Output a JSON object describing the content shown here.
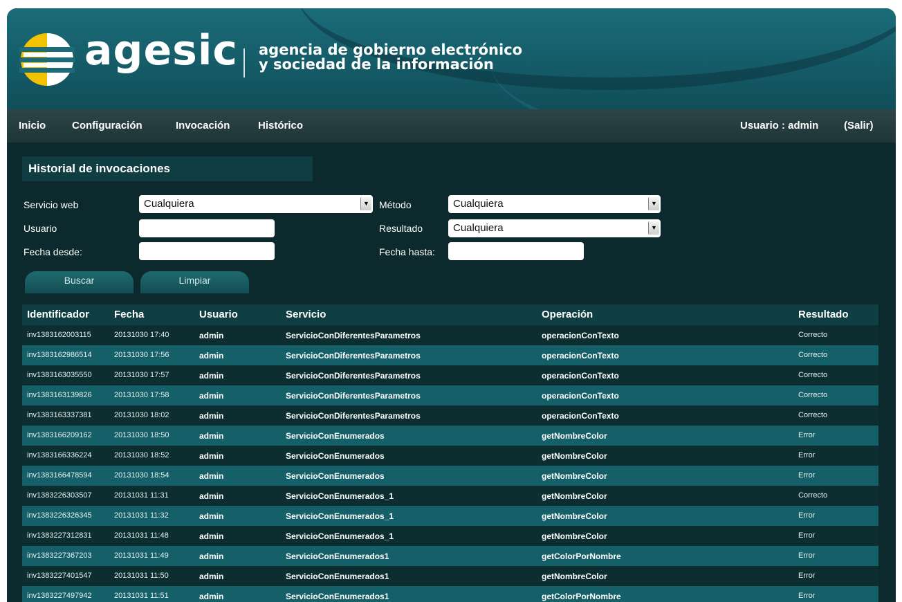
{
  "brand": {
    "name": "agesic",
    "tagline_line1": "agencia de gobierno electrónico",
    "tagline_line2": "y sociedad de la información"
  },
  "nav": {
    "items": [
      "Inicio",
      "Configuración",
      "Invocación",
      "Histórico"
    ],
    "user_label": "Usuario : admin",
    "logout": "(Salir)"
  },
  "page": {
    "title": "Historial de invocaciones"
  },
  "filters": {
    "servicio_label": "Servicio web",
    "servicio_value": "Cualquiera",
    "metodo_label": "Método",
    "metodo_value": "Cualquiera",
    "usuario_label": "Usuario",
    "usuario_value": "",
    "resultado_label": "Resultado",
    "resultado_value": "Cualquiera",
    "fecha_desde_label": "Fecha desde:",
    "fecha_desde_value": "",
    "fecha_hasta_label": "Fecha hasta:",
    "fecha_hasta_value": ""
  },
  "buttons": {
    "search": "Buscar",
    "clear": "Limpiar"
  },
  "table": {
    "headers": [
      "Identificador",
      "Fecha",
      "Usuario",
      "Servicio",
      "Operación",
      "Resultado"
    ],
    "rows": [
      [
        "inv1383162003115",
        "20131030 17:40",
        "admin",
        "ServicioConDiferentesParametros",
        "operacionConTexto",
        "Correcto"
      ],
      [
        "inv1383162986514",
        "20131030 17:56",
        "admin",
        "ServicioConDiferentesParametros",
        "operacionConTexto",
        "Correcto"
      ],
      [
        "inv1383163035550",
        "20131030 17:57",
        "admin",
        "ServicioConDiferentesParametros",
        "operacionConTexto",
        "Correcto"
      ],
      [
        "inv1383163139826",
        "20131030 17:58",
        "admin",
        "ServicioConDiferentesParametros",
        "operacionConTexto",
        "Correcto"
      ],
      [
        "inv1383163337381",
        "20131030 18:02",
        "admin",
        "ServicioConDiferentesParametros",
        "operacionConTexto",
        "Correcto"
      ],
      [
        "inv1383166209162",
        "20131030 18:50",
        "admin",
        "ServicioConEnumerados",
        "getNombreColor",
        "Error"
      ],
      [
        "inv1383166336224",
        "20131030 18:52",
        "admin",
        "ServicioConEnumerados",
        "getNombreColor",
        "Error"
      ],
      [
        "inv1383166478594",
        "20131030 18:54",
        "admin",
        "ServicioConEnumerados",
        "getNombreColor",
        "Error"
      ],
      [
        "inv1383226303507",
        "20131031 11:31",
        "admin",
        "ServicioConEnumerados_1",
        "getNombreColor",
        "Correcto"
      ],
      [
        "inv1383226326345",
        "20131031 11:32",
        "admin",
        "ServicioConEnumerados_1",
        "getNombreColor",
        "Error"
      ],
      [
        "inv1383227312831",
        "20131031 11:48",
        "admin",
        "ServicioConEnumerados_1",
        "getNombreColor",
        "Error"
      ],
      [
        "inv1383227367203",
        "20131031 11:49",
        "admin",
        "ServicioConEnumerados1",
        "getColorPorNombre",
        "Error"
      ],
      [
        "inv1383227401547",
        "20131031 11:50",
        "admin",
        "ServicioConEnumerados1",
        "getNombreColor",
        "Error"
      ],
      [
        "inv1383227497942",
        "20131031 11:51",
        "admin",
        "ServicioConEnumerados1",
        "getColorPorNombre",
        "Error"
      ]
    ]
  },
  "colors": {
    "header": "#1b6b79",
    "nav": "#2d4547",
    "background": "#0c2a2d",
    "row_alt": "#156068",
    "logo_yellow": "#f2c200"
  },
  "icons": {
    "logo": "agesic-logo-icon",
    "dropdown": "chevron-down-icon"
  }
}
